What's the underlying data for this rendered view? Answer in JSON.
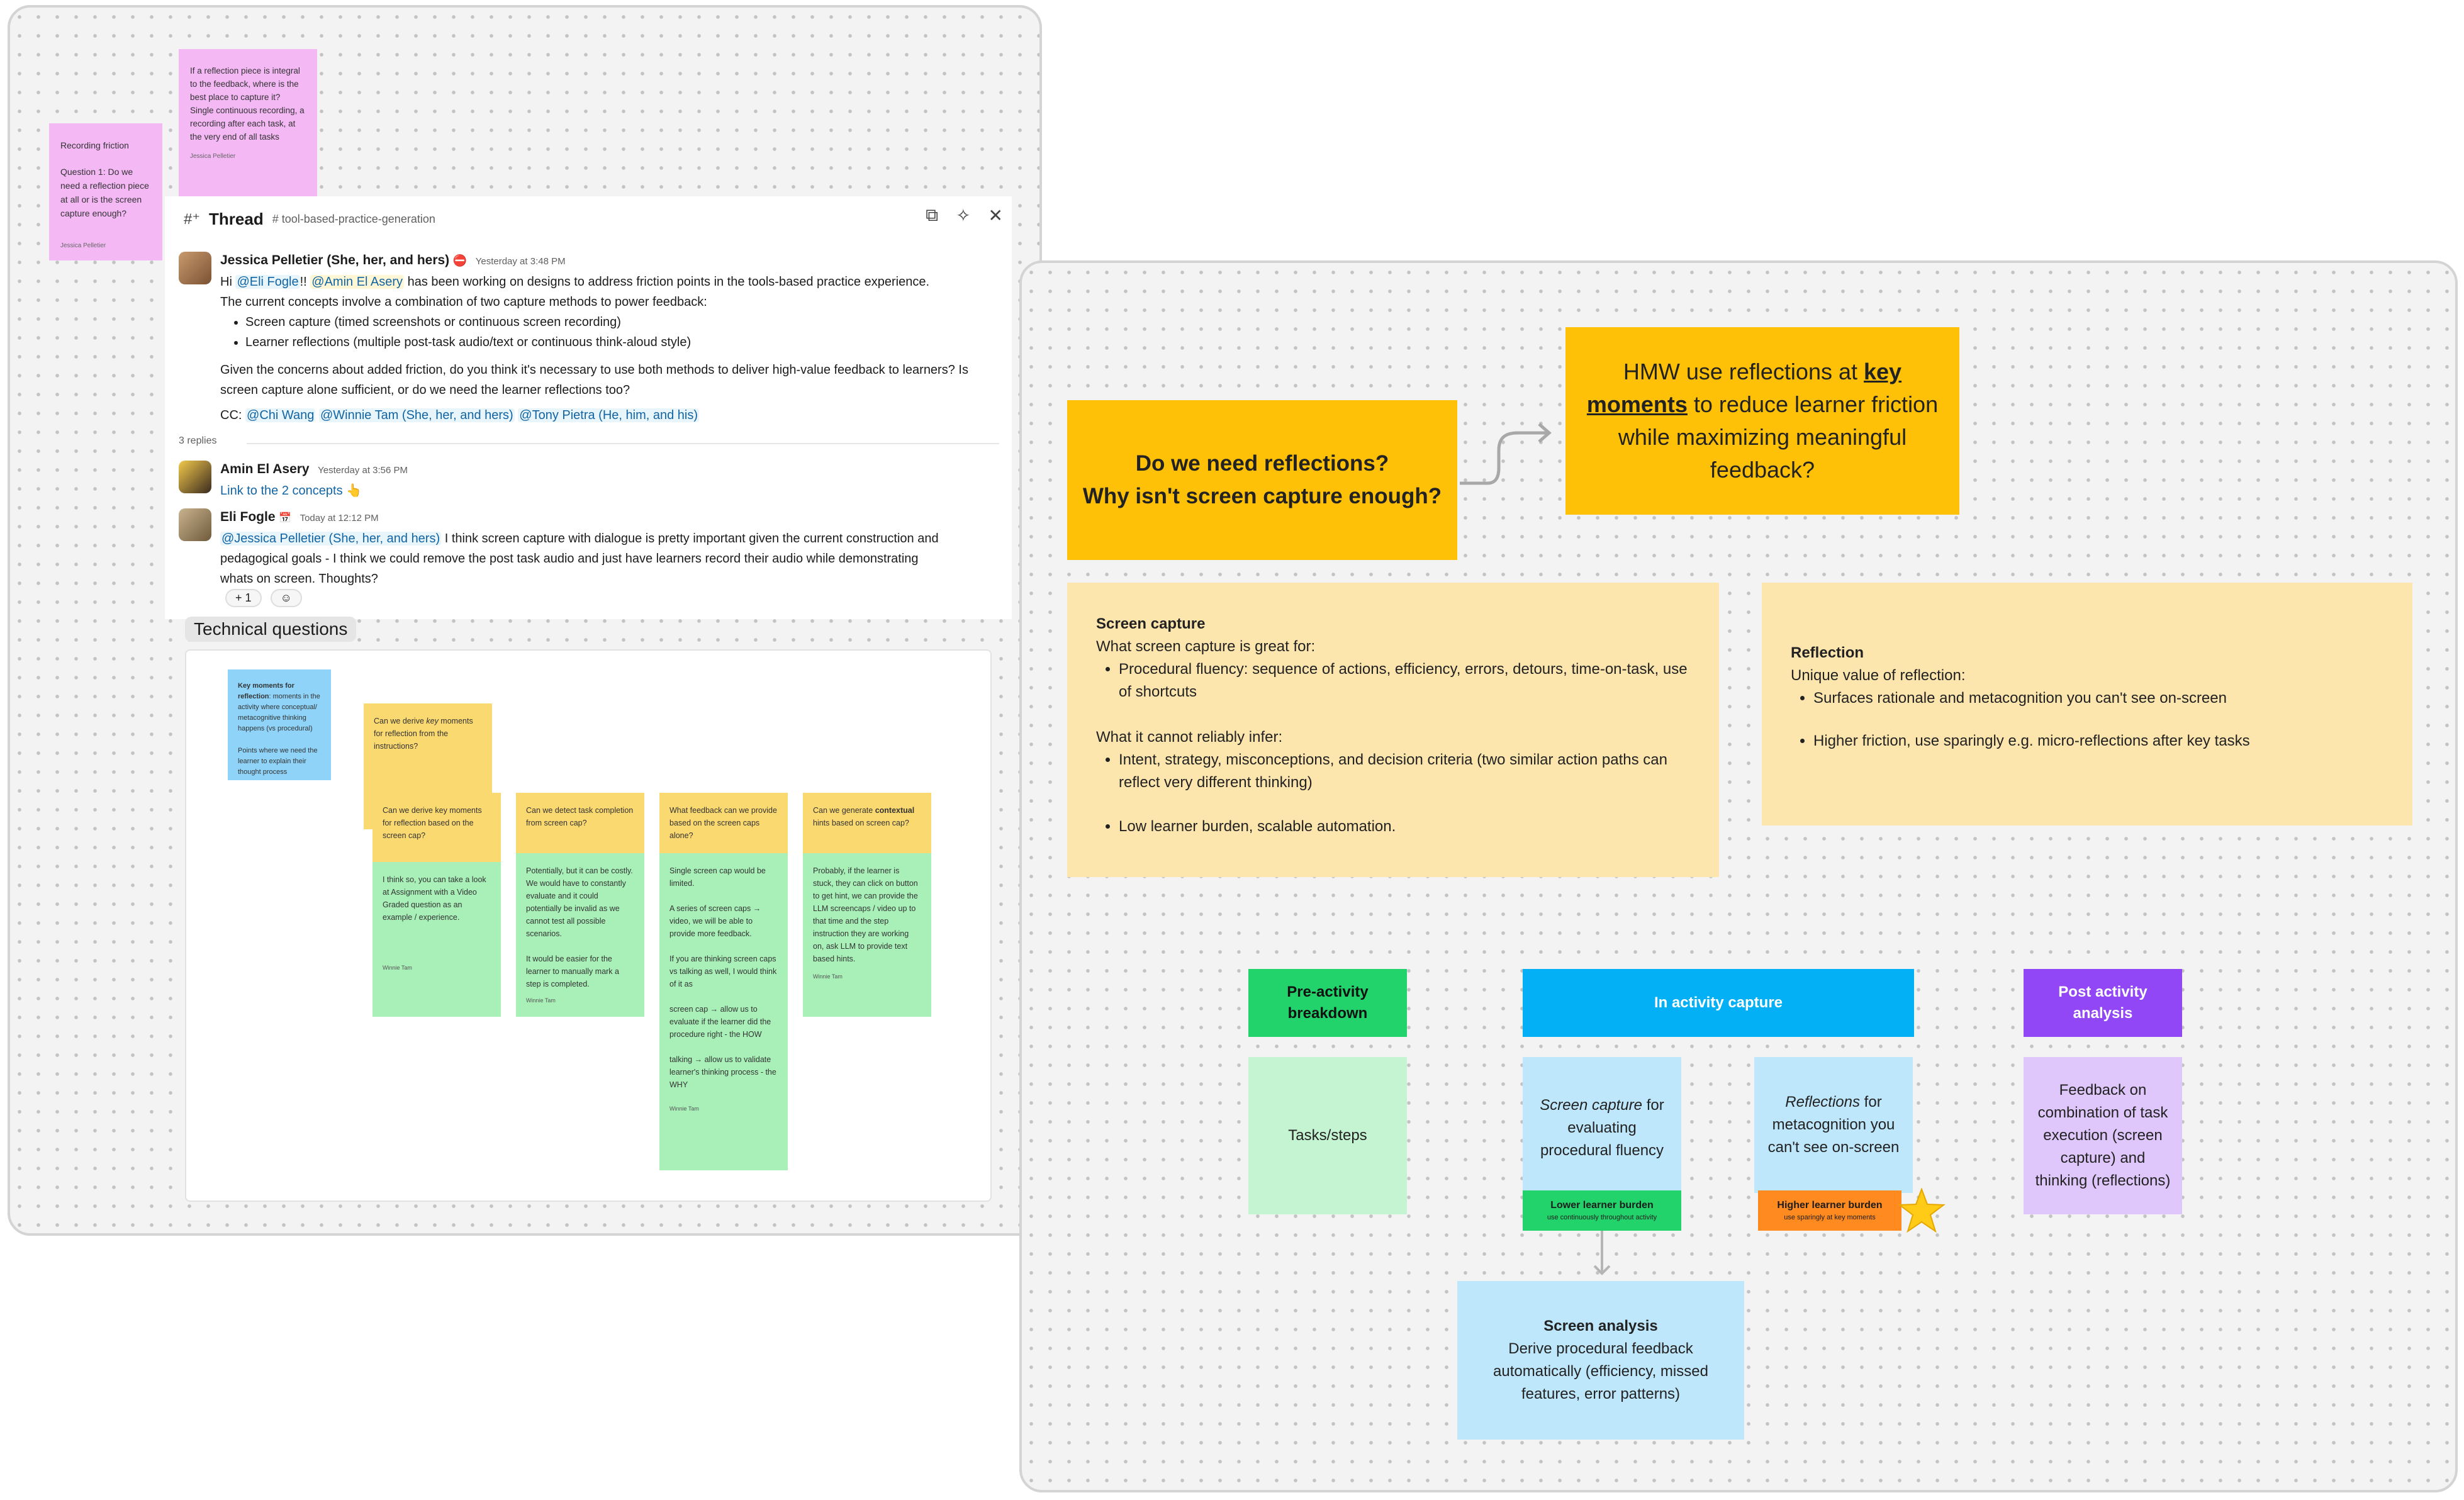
{
  "left_board": {
    "notes": {
      "recording_friction": {
        "title": "Recording friction",
        "body": "Question 1: Do we need a reflection piece at all or is the screen capture enough?",
        "author": "Jessica Pelletier"
      },
      "reflection_piece": {
        "body": "If a reflection piece is integral to the feedback, where is the best place to capture it? Single continuous recording, a recording after each task, at the very end of all tasks",
        "author": "Jessica Pelletier"
      }
    },
    "thread": {
      "title": "Thread",
      "channel": "# tool-based-practice-generation",
      "messages": [
        {
          "name": "Jessica Pelletier (She, her, and hers)",
          "status_icon": "no-entry-icon",
          "time": "Yesterday at 3:48 PM",
          "hi": "Hi",
          "mention_1": "@Eli Fogle",
          "bang": "!!",
          "mention_2": "@Amin El Asery",
          "line_1": "has been working on designs to address friction points in the tools-based practice experience.",
          "line_2": "The current concepts involve a combination of two capture methods to power feedback:",
          "bullets": [
            "Screen capture (timed screenshots or continuous screen recording)",
            "Learner reflections (multiple post-task audio/text or continuous think-aloud style)"
          ],
          "paragraph": "Given the concerns about added friction, do you think it's necessary to use both methods to deliver high-value feedback to learners? Is screen capture alone sufficient, or do we need the learner reflections too?",
          "cc_label": "CC:",
          "cc_mentions": [
            "@Chi Wang",
            "@Winnie Tam (She, her, and hers)",
            "@Tony Pietra (He, him, and his)"
          ]
        },
        {
          "name": "Amin El Asery",
          "time": "Yesterday at 3:56 PM",
          "link_text": "Link to the 2 concepts",
          "emoji": "👆"
        },
        {
          "name": "Eli Fogle",
          "status_icon": "calendar-icon",
          "time": "Today at 12:12 PM",
          "mention": "@Jessica Pelletier (She, her, and hers)",
          "text_1": "I think screen capture with dialogue is pretty important given the current construction and",
          "text_2": "pedagogical goals - I think we could remove the post task audio and just have learners record their audio while demonstrating",
          "text_3": "whats on screen.  Thoughts?"
        }
      ],
      "replies_count": "3 replies",
      "reaction": "+ 1",
      "reaction_add_icon": "add-reaction-icon"
    },
    "technical_questions": {
      "label": "Technical questions",
      "key_moments_note": {
        "bold": "Key moments for reflection",
        "text": ": moments in the activity where conceptual/ metacognitive thinking happens (vs procedural)",
        "text_2": "Points where we need the learner to explain their thought process"
      },
      "derive_key_note": {
        "text_a": "Can we derive ",
        "italic": "key",
        "text_b": " moments for reflection from the instructions?"
      },
      "questions": [
        {
          "question": "Can we derive key moments for reflection based on the screen cap?",
          "answer": "I think so, you can take a look at Assignment with a Video Graded question as an example / experience.",
          "author": "Winnie Tam"
        },
        {
          "question": "Can we detect task completion from screen cap?",
          "answer": "Potentially, but it can be costly.  We would have to constantly evaluate and it could potentially be invalid as we cannot test all possible scenarios.",
          "answer_2": "It would be easier for the learner to manually mark a step is completed.",
          "author": "Winnie Tam"
        },
        {
          "question": "What feedback can we provide based on the screen caps alone?",
          "answer": "Single screen cap would be limited.",
          "answer_2": "A series of screen caps → video, we will be able to provide more feedback.",
          "answer_3": "If you are thinking screen caps vs talking as well, I would think of it as",
          "answer_4": "screen cap → allow us to evaluate if the learner did the procedure right - the HOW",
          "answer_5": "talking → allow us to validate learner's thinking process - the WHY",
          "author": "Winnie Tam"
        },
        {
          "question_a": "Can we generate ",
          "question_bold": "contextual",
          "question_b": " hints based on screen cap?",
          "answer": "Probably, if the learner is stuck, they can click on button to get hint, we can provide the LLM screencaps / video up to that time and the step instruction they are working on, ask LLM to provide text based hints.",
          "author": "Winnie Tam"
        }
      ]
    }
  },
  "right_board": {
    "main_question": {
      "line_1": "Do we need reflections?",
      "line_2": "Why isn't screen capture enough?"
    },
    "hmw": {
      "text_1": "HMW use reflections at ",
      "bold_1": "key",
      "bold_2": "moments",
      "text_2": " to reduce learner friction while maximizing meaningful feedback?"
    },
    "screen_capture": {
      "title": "Screen capture",
      "great_for": "What screen capture is great for:",
      "great_items": [
        "Procedural fluency: sequence of actions, efficiency, errors, detours, time-on-task, use of shortcuts"
      ],
      "cannot": "What it cannot reliably infer:",
      "cannot_items": [
        "Intent, strategy, misconceptions, and decision criteria (two similar action paths can reflect very different thinking)"
      ],
      "extra_items": [
        "Low learner burden, scalable automation."
      ]
    },
    "reflection": {
      "title": "Reflection",
      "unique": "Unique value of reflection:",
      "items": [
        "Surfaces rationale and metacognition you can't see on-screen",
        "Higher friction, use sparingly e.g. micro-reflections after key tasks"
      ]
    },
    "phases": {
      "pre": {
        "label_1": "Pre-activity",
        "label_2": "breakdown",
        "color": "#21d36a"
      },
      "in": {
        "label": "In activity capture",
        "color": "#03b0f5"
      },
      "post": {
        "label_1": "Post activity",
        "label_2": "analysis",
        "color": "#9147f5"
      }
    },
    "cards": {
      "tasks": "Tasks/steps",
      "screen_capture_italic": "Screen capture",
      "screen_capture_rest": " for evaluating procedural fluency",
      "reflections_italic": "Reflections",
      "reflections_rest": " for metacognition you can't see on-screen",
      "post_analysis": "Feedback on combination of task execution (screen capture) and thinking (reflections)",
      "lower_burden": "Lower learner burden",
      "lower_burden_sub": "use continuously throughout activity",
      "higher_burden": "Higher learner burden",
      "higher_burden_sub": "use sparingly at key moments",
      "screen_analysis_title": "Screen analysis",
      "screen_analysis_body": "Derive procedural feedback automatically (efficiency, missed features, error patterns)"
    }
  }
}
